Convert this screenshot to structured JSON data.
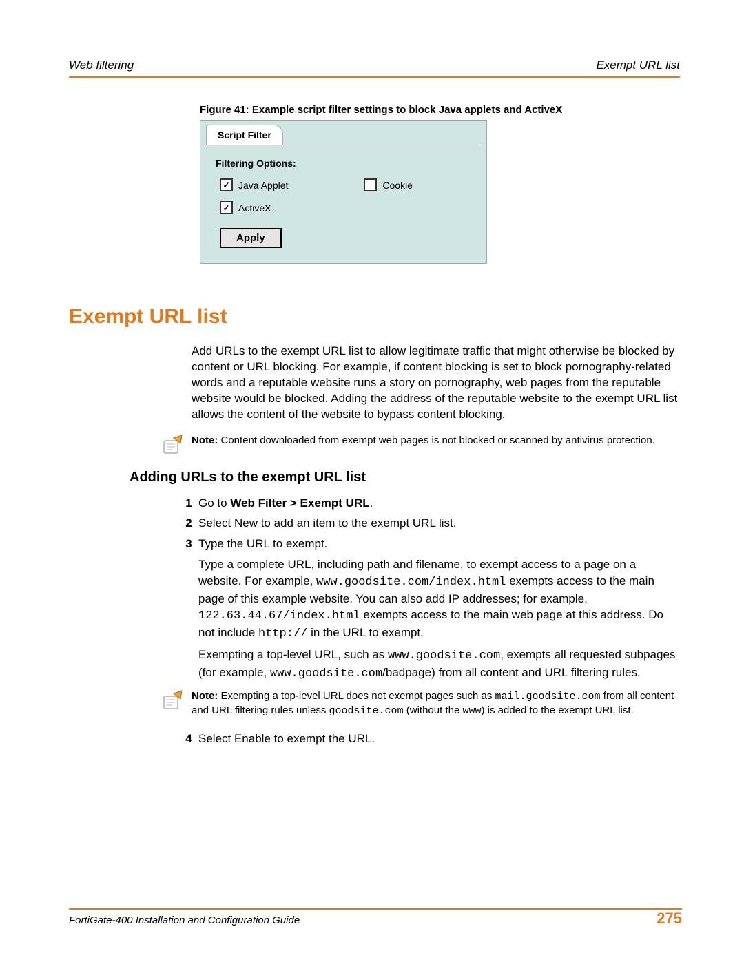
{
  "header": {
    "left": "Web filtering",
    "right": "Exempt URL list"
  },
  "figure": {
    "caption": "Figure 41: Example script filter settings to block Java applets and ActiveX",
    "tab": "Script Filter",
    "options_title": "Filtering Options:",
    "java": "Java Applet",
    "cookie": "Cookie",
    "activex": "ActiveX",
    "java_checked": true,
    "cookie_checked": false,
    "activex_checked": true,
    "apply": "Apply"
  },
  "section_title": "Exempt URL list",
  "intro": "Add URLs to the exempt URL list to allow legitimate traffic that might otherwise be blocked by content or URL blocking. For example, if content blocking is set to block pornography-related words and a reputable website runs a story on pornography, web pages from the reputable website would be blocked. Adding the address of the reputable website to the exempt URL list allows the content of the website to bypass content blocking.",
  "note1_bold": "Note:",
  "note1_rest": " Content downloaded from exempt web pages is not blocked or scanned by antivirus protection.",
  "subheading": "Adding URLs to the exempt URL list",
  "steps": {
    "s1_prefix": "Go to ",
    "s1_bold": "Web Filter > Exempt URL",
    "s1_suffix": ".",
    "s2": "Select New to add an item to the exempt URL list.",
    "s3": "Type the URL to exempt.",
    "s3p1_a": "Type a complete URL, including path and filename, to exempt access to a page on a website. For example, ",
    "s3p1_code1": "www.goodsite.com/index.html",
    "s3p1_b": " exempts access to the main page of this example website. You can also add IP addresses; for example, ",
    "s3p1_code2": "122.63.44.67/index.html",
    "s3p1_c": " exempts access to the main web page at this address. Do not include ",
    "s3p1_code3": "http://",
    "s3p1_d": " in the URL to exempt.",
    "s3p2_a": "Exempting a top-level URL, such as ",
    "s3p2_code1": "www.goodsite.com",
    "s3p2_b": ", exempts all requested subpages (for example, ",
    "s3p2_code2": "www.goodsite.com",
    "s3p2_c": "/badpage) from all content and URL filtering rules.",
    "s4": "Select Enable to exempt the URL."
  },
  "note2_bold": "Note:",
  "note2_a": " Exempting a top-level URL does not exempt pages such as ",
  "note2_code1": "mail.goodsite.com",
  "note2_b": " from all content and URL filtering rules unless ",
  "note2_code2": "goodsite.com",
  "note2_c": " (without the ",
  "note2_code3": "www",
  "note2_d": ") is added to the exempt URL list.",
  "footer": {
    "left": "FortiGate-400 Installation and Configuration Guide",
    "page": "275"
  }
}
